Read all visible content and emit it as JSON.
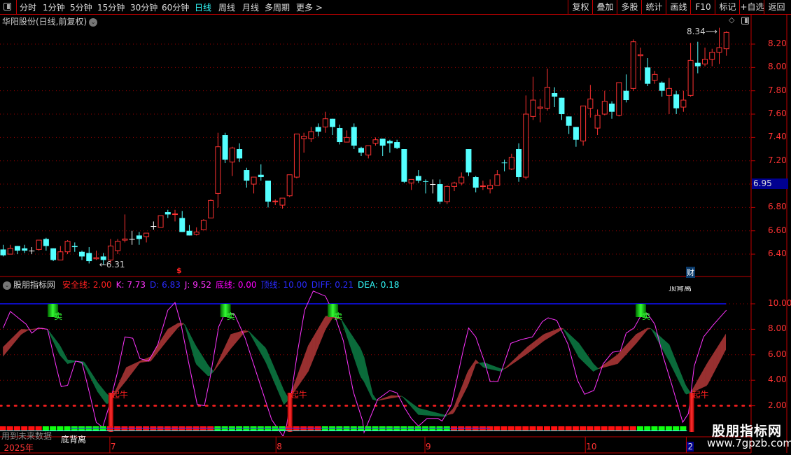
{
  "toolbar": {
    "periods": [
      {
        "label": "分时",
        "active": false
      },
      {
        "label": "1分钟",
        "active": false
      },
      {
        "label": "5分钟",
        "active": false
      },
      {
        "label": "15分钟",
        "active": false
      },
      {
        "label": "30分钟",
        "active": false
      },
      {
        "label": "60分钟",
        "active": false
      },
      {
        "label": "日线",
        "active": true
      },
      {
        "label": "周线",
        "active": false
      },
      {
        "label": "月线",
        "active": false
      },
      {
        "label": "多周期",
        "active": false
      },
      {
        "label": "更多 >",
        "active": false
      }
    ],
    "buttons": [
      "复权",
      "叠加",
      "多股",
      "统计",
      "画线",
      "F10",
      "标记",
      "+自选",
      "返回"
    ]
  },
  "chart_title": "华阳股份(日线,前复权)",
  "price_axis": [
    "8.20",
    "8.00",
    "7.80",
    "7.60",
    "7.40",
    "7.20",
    "6.80",
    "6.60",
    "6.40"
  ],
  "current_price_label": "6.95",
  "annotations": {
    "low_label": "6.31",
    "high_label": "8.34",
    "event_marker": "$",
    "finance_marker": "财"
  },
  "indicator": {
    "name": "股朋指标网",
    "values": [
      {
        "text": "安全线: 2.00",
        "color": "#ff2020"
      },
      {
        "text": "K: 7.73",
        "color": "#ff33ff"
      },
      {
        "text": "D: 6.83",
        "color": "#2a2aff"
      },
      {
        "text": "J: 9.52",
        "color": "#ff33ff"
      },
      {
        "text": "底线: 0.00",
        "color": "#ff00ff"
      },
      {
        "text": "顶线: 10.00",
        "color": "#2a2aff"
      },
      {
        "text": "DIFF: 0.21",
        "color": "#2a2aff"
      },
      {
        "text": "DEA: 0.18",
        "color": "#33ffff"
      }
    ],
    "axis": [
      "10.00",
      "8.00",
      "6.00",
      "4.00",
      "2.00"
    ],
    "sell_label": "卖",
    "buy_label": "起牛",
    "top_divergence": "顶背离",
    "bottom_divergence": "底背离",
    "future_data_note": "用到未来数据"
  },
  "time_axis": [
    {
      "label": "2025年",
      "index": 0
    },
    {
      "label": "7",
      "index": 14.9
    },
    {
      "label": "8",
      "index": 38.1
    },
    {
      "label": "9",
      "index": 58.9
    },
    {
      "label": "10",
      "index": 81.3
    },
    {
      "label": "2",
      "index": 95.4,
      "highlight": true
    }
  ],
  "watermark": {
    "title": "股朋指标网",
    "url": "www.7gpzb.com"
  },
  "colors": {
    "up": "#ff3232",
    "down": "#54ffff",
    "doji": "#ffffff",
    "rise_band": "#983030",
    "fall_band": "#0b6b3b",
    "j_line": "#ff33ff",
    "top_line": "#1010ff",
    "grid": "#a00000"
  },
  "chart_data": {
    "type": "candlestick",
    "ohlc_fields": [
      "open",
      "high",
      "low",
      "close"
    ],
    "ylim": [
      6.3,
      8.4
    ],
    "low_index": 14,
    "high_index": 100,
    "candles": [
      [
        6.44,
        6.48,
        6.38,
        6.39
      ],
      [
        6.4,
        6.48,
        6.4,
        6.45
      ],
      [
        6.47,
        6.47,
        6.4,
        6.43
      ],
      [
        6.45,
        6.48,
        6.41,
        6.43
      ],
      [
        6.43,
        6.46,
        6.4,
        6.43
      ],
      [
        6.44,
        6.52,
        6.43,
        6.52
      ],
      [
        6.53,
        6.54,
        6.43,
        6.47
      ],
      [
        6.45,
        6.45,
        6.34,
        6.35
      ],
      [
        6.35,
        6.47,
        6.35,
        6.42
      ],
      [
        6.42,
        6.52,
        6.4,
        6.51
      ],
      [
        6.47,
        6.5,
        6.42,
        6.46
      ],
      [
        6.42,
        6.43,
        6.35,
        6.38
      ],
      [
        6.41,
        6.46,
        6.32,
        6.34
      ],
      [
        6.36,
        6.43,
        6.35,
        6.37
      ],
      [
        6.38,
        6.41,
        6.31,
        6.35
      ],
      [
        6.35,
        6.53,
        6.32,
        6.47
      ],
      [
        6.43,
        6.53,
        6.4,
        6.51
      ],
      [
        6.52,
        6.74,
        6.5,
        6.53
      ],
      [
        6.53,
        6.6,
        6.48,
        6.53
      ],
      [
        6.56,
        6.59,
        6.48,
        6.53
      ],
      [
        6.55,
        6.58,
        6.5,
        6.58
      ],
      [
        6.64,
        6.68,
        6.61,
        6.64
      ],
      [
        6.63,
        6.73,
        6.63,
        6.73
      ],
      [
        6.76,
        6.78,
        6.71,
        6.74
      ],
      [
        6.74,
        6.78,
        6.68,
        6.745
      ],
      [
        6.71,
        6.77,
        6.59,
        6.59
      ],
      [
        6.6,
        6.65,
        6.56,
        6.56
      ],
      [
        6.57,
        6.63,
        6.56,
        6.59
      ],
      [
        6.61,
        6.7,
        6.61,
        6.69
      ],
      [
        6.71,
        6.87,
        6.71,
        6.86
      ],
      [
        6.92,
        7.44,
        6.8,
        7.32
      ],
      [
        7.42,
        7.44,
        7.18,
        7.21
      ],
      [
        7.19,
        7.32,
        7.07,
        7.31
      ],
      [
        7.3,
        7.35,
        7.19,
        7.22
      ],
      [
        7.12,
        7.14,
        6.97,
        7.03
      ],
      [
        7.0,
        7.06,
        6.92,
        7.06
      ],
      [
        7.08,
        7.17,
        7.03,
        7.06
      ],
      [
        7.03,
        7.03,
        6.8,
        6.85
      ],
      [
        6.85,
        6.87,
        6.82,
        6.855
      ],
      [
        6.82,
        6.88,
        6.79,
        6.88
      ],
      [
        6.9,
        7.08,
        6.89,
        7.08
      ],
      [
        7.06,
        7.43,
        7.05,
        7.43
      ],
      [
        7.39,
        7.44,
        7.27,
        7.41
      ],
      [
        7.39,
        7.49,
        7.36,
        7.45
      ],
      [
        7.49,
        7.52,
        7.41,
        7.45
      ],
      [
        7.49,
        7.62,
        7.44,
        7.56
      ],
      [
        7.56,
        7.56,
        7.42,
        7.49
      ],
      [
        7.48,
        7.51,
        7.34,
        7.36
      ],
      [
        7.36,
        7.46,
        7.36,
        7.4
      ],
      [
        7.49,
        7.52,
        7.3,
        7.33
      ],
      [
        7.31,
        7.32,
        7.24,
        7.27
      ],
      [
        7.25,
        7.33,
        7.22,
        7.33
      ],
      [
        7.35,
        7.4,
        7.33,
        7.38
      ],
      [
        7.39,
        7.39,
        7.24,
        7.33
      ],
      [
        7.37,
        7.38,
        7.27,
        7.35
      ],
      [
        7.36,
        7.38,
        7.3,
        7.31
      ],
      [
        7.3,
        7.3,
        7.01,
        7.02
      ],
      [
        7.01,
        7.04,
        6.95,
        7.04
      ],
      [
        7.07,
        7.12,
        7.01,
        7.03
      ],
      [
        7.025,
        7.04,
        6.92,
        7.02
      ],
      [
        7.0,
        7.04,
        6.92,
        7.0
      ],
      [
        7.0,
        7.04,
        6.83,
        6.85
      ],
      [
        6.85,
        6.99,
        6.83,
        6.98
      ],
      [
        6.98,
        7.02,
        6.94,
        7.01
      ],
      [
        7.01,
        7.1,
        6.99,
        7.06
      ],
      [
        7.3,
        7.3,
        7.07,
        7.1
      ],
      [
        7.06,
        7.07,
        6.93,
        6.97
      ],
      [
        6.98,
        7.03,
        6.95,
        6.985
      ],
      [
        6.96,
        7.04,
        6.92,
        6.99
      ],
      [
        6.99,
        7.12,
        6.99,
        7.08
      ],
      [
        7.185,
        7.21,
        7.11,
        7.18
      ],
      [
        7.13,
        7.26,
        7.12,
        7.23
      ],
      [
        7.3,
        7.35,
        7.02,
        7.06
      ],
      [
        7.06,
        7.76,
        7.04,
        7.6
      ],
      [
        7.58,
        7.92,
        7.55,
        7.72
      ],
      [
        7.65,
        7.73,
        7.53,
        7.66
      ],
      [
        7.65,
        7.99,
        7.63,
        7.83
      ],
      [
        7.78,
        7.83,
        7.66,
        7.75
      ],
      [
        7.74,
        7.74,
        7.55,
        7.6
      ],
      [
        7.58,
        7.58,
        7.43,
        7.5
      ],
      [
        7.49,
        7.49,
        7.32,
        7.38
      ],
      [
        7.37,
        7.67,
        7.33,
        7.67
      ],
      [
        7.65,
        7.85,
        7.57,
        7.73
      ],
      [
        7.48,
        7.64,
        7.42,
        7.59
      ],
      [
        7.6,
        7.8,
        7.59,
        7.71
      ],
      [
        7.69,
        7.71,
        7.56,
        7.62
      ],
      [
        7.59,
        7.87,
        7.58,
        7.87
      ],
      [
        7.8,
        7.94,
        7.7,
        7.72
      ],
      [
        7.82,
        8.24,
        7.8,
        8.22
      ],
      [
        8.1,
        8.17,
        7.89,
        8.11
      ],
      [
        8.0,
        8.08,
        7.84,
        7.86
      ],
      [
        7.89,
        7.97,
        7.86,
        7.94
      ],
      [
        7.87,
        7.88,
        7.75,
        7.8
      ],
      [
        7.76,
        7.91,
        7.6,
        7.82
      ],
      [
        7.77,
        7.8,
        7.6,
        7.65
      ],
      [
        7.66,
        7.8,
        7.62,
        7.72
      ],
      [
        7.76,
        8.21,
        7.75,
        8.06
      ],
      [
        8.04,
        8.22,
        7.95,
        8.01
      ],
      [
        8.03,
        8.17,
        8.01,
        8.07
      ],
      [
        8.07,
        8.16,
        8.01,
        8.13
      ],
      [
        8.13,
        8.34,
        8.03,
        8.17
      ],
      [
        8.16,
        8.31,
        8.1,
        8.3
      ]
    ],
    "indicator": {
      "ylim": [
        0,
        10
      ],
      "top_line": 10,
      "safety_line": 2,
      "kd_keyframes_index_k_d": [
        [
          0,
          6.6,
          5.9
        ],
        [
          2.5,
          8.0,
          7.6
        ],
        [
          3.5,
          7.97,
          7.95
        ],
        [
          5.4,
          8.1,
          8.05
        ],
        [
          6.2,
          8.0,
          8.0
        ],
        [
          7.9,
          6.0,
          6.75
        ],
        [
          9.0,
          5.3,
          5.6
        ],
        [
          10.3,
          5.5,
          5.5
        ],
        [
          11.3,
          5.2,
          5.45
        ],
        [
          13.2,
          3.1,
          3.8
        ],
        [
          14.5,
          2.1,
          2.9
        ],
        [
          15.2,
          2.6,
          2.6
        ],
        [
          17.2,
          5.0,
          4.0
        ],
        [
          19.1,
          5.5,
          5.4
        ],
        [
          20.6,
          5.85,
          5.5
        ],
        [
          23.0,
          8.0,
          7.2
        ],
        [
          24.5,
          8.5,
          8.2
        ],
        [
          25.3,
          8.45,
          8.45
        ],
        [
          26.9,
          5.3,
          6.7
        ],
        [
          28.7,
          4.3,
          5.1
        ],
        [
          29.4,
          4.7,
          4.7
        ],
        [
          31.8,
          7.6,
          6.5
        ],
        [
          33.6,
          7.9,
          7.7
        ],
        [
          34.3,
          7.85,
          7.85
        ],
        [
          36.7,
          5.4,
          6.5
        ],
        [
          39.2,
          2.1,
          3.2
        ],
        [
          39.9,
          2.5,
          2.5
        ],
        [
          42.6,
          6.7,
          4.7
        ],
        [
          45.0,
          9.0,
          8.0
        ],
        [
          46.0,
          9.15,
          8.9
        ],
        [
          47.2,
          8.8,
          8.8
        ],
        [
          49.9,
          4.3,
          6.5
        ],
        [
          50.4,
          3.9,
          5.8
        ],
        [
          51.6,
          2.5,
          2.9
        ],
        [
          52.2,
          2.4,
          2.4
        ],
        [
          54.2,
          2.8,
          2.6
        ],
        [
          55.7,
          2.75,
          2.75
        ],
        [
          58.0,
          1.3,
          1.8
        ],
        [
          61.8,
          1.15,
          1.25
        ],
        [
          62.9,
          1.8,
          1.4
        ],
        [
          64.9,
          4.7,
          3.6
        ],
        [
          66.0,
          5.6,
          5.3
        ],
        [
          67.1,
          5.0,
          5.4
        ],
        [
          69.5,
          4.7,
          4.9
        ],
        [
          70.1,
          4.95,
          4.9
        ],
        [
          73.2,
          6.6,
          6.1
        ],
        [
          75.5,
          7.6,
          7.1
        ],
        [
          77.8,
          8.1,
          7.9
        ],
        [
          78.2,
          8.05,
          8.05
        ],
        [
          80.4,
          5.8,
          6.9
        ],
        [
          82.4,
          4.7,
          5.3
        ],
        [
          83.1,
          4.9,
          4.9
        ],
        [
          85.8,
          6.0,
          5.3
        ],
        [
          88.4,
          7.6,
          6.9
        ],
        [
          90.0,
          8.1,
          8.0
        ],
        [
          90.5,
          8.05,
          8.05
        ],
        [
          93.0,
          5.5,
          6.8
        ],
        [
          95.3,
          2.9,
          3.6
        ],
        [
          96.0,
          3.0,
          3.0
        ],
        [
          98.3,
          5.3,
          3.6
        ],
        [
          100.9,
          7.6,
          6.4
        ]
      ],
      "j_keyframes_index_value": [
        [
          0,
          8.1
        ],
        [
          1.0,
          9.4
        ],
        [
          3.2,
          8.4
        ],
        [
          4.0,
          7.7
        ],
        [
          4.9,
          8.1
        ],
        [
          6.2,
          8.0
        ],
        [
          7.4,
          5.1
        ],
        [
          8.1,
          3.5
        ],
        [
          9.0,
          3.6
        ],
        [
          10.1,
          5.5
        ],
        [
          11.0,
          5.4
        ],
        [
          12.1,
          2.9
        ],
        [
          13.0,
          0.7
        ],
        [
          13.9,
          0.3
        ],
        [
          14.7,
          1.8
        ],
        [
          16.0,
          4.7
        ],
        [
          17.0,
          7.4
        ],
        [
          18.1,
          7.3
        ],
        [
          19.1,
          5.7
        ],
        [
          20.3,
          5.5
        ],
        [
          21.6,
          6.8
        ],
        [
          23.0,
          9.5
        ],
        [
          24.0,
          10.1
        ],
        [
          24.8,
          8.5
        ],
        [
          25.9,
          5.4
        ],
        [
          27.1,
          2.1
        ],
        [
          28.1,
          2.0
        ],
        [
          28.9,
          4.2
        ],
        [
          30.1,
          8.2
        ],
        [
          31.0,
          9.3
        ],
        [
          32.3,
          9.2
        ],
        [
          33.8,
          7.3
        ],
        [
          35.7,
          4.0
        ],
        [
          37.5,
          0.9
        ],
        [
          39.1,
          -0.4
        ],
        [
          39.6,
          0.5
        ],
        [
          41.1,
          6.2
        ],
        [
          42.1,
          9.5
        ],
        [
          43.3,
          11.0
        ],
        [
          45.0,
          10.6
        ],
        [
          46.3,
          9.1
        ],
        [
          47.5,
          7.1
        ],
        [
          48.9,
          3.1
        ],
        [
          50.2,
          0.8
        ],
        [
          50.4,
          -0.1
        ],
        [
          52.3,
          2.5
        ],
        [
          54.0,
          3.2
        ],
        [
          55.0,
          3.0
        ],
        [
          56.1,
          1.8
        ],
        [
          57.0,
          1.0
        ],
        [
          58.0,
          0.4
        ],
        [
          59.2,
          1.0
        ],
        [
          60.7,
          1.0
        ],
        [
          61.3,
          0.8
        ],
        [
          62.6,
          2.1
        ],
        [
          64.3,
          6.5
        ],
        [
          65.0,
          8.1
        ],
        [
          66.0,
          7.4
        ],
        [
          67.3,
          5.3
        ],
        [
          68.0,
          3.9
        ],
        [
          69.1,
          3.9
        ],
        [
          70.9,
          6.9
        ],
        [
          72.4,
          7.2
        ],
        [
          73.9,
          7.4
        ],
        [
          75.3,
          8.6
        ],
        [
          76.1,
          8.9
        ],
        [
          77.3,
          8.7
        ],
        [
          78.9,
          6.8
        ],
        [
          80.2,
          4.0
        ],
        [
          81.2,
          2.9
        ],
        [
          82.5,
          3.2
        ],
        [
          83.8,
          5.3
        ],
        [
          85.1,
          6.2
        ],
        [
          86.2,
          6.3
        ],
        [
          87.0,
          7.7
        ],
        [
          88.1,
          8.1
        ],
        [
          89.2,
          9.2
        ],
        [
          90.0,
          9.2
        ],
        [
          91.0,
          8.4
        ],
        [
          92.2,
          5.8
        ],
        [
          93.4,
          3.6
        ],
        [
          94.9,
          0.7
        ],
        [
          95.7,
          1.4
        ],
        [
          96.5,
          5.1
        ],
        [
          97.8,
          7.4
        ],
        [
          99.1,
          8.3
        ],
        [
          101,
          9.5
        ]
      ],
      "sell_signals_index": [
        6.9,
        31.0,
        46.0,
        89.0
      ],
      "buy_signals_index": [
        15.0,
        40.0,
        96.1
      ],
      "strip_segments": [
        {
          "from": 0,
          "to": 5,
          "color": "red"
        },
        {
          "from": 6,
          "to": 14,
          "color": "green"
        },
        {
          "from": 15,
          "to": 29,
          "color": "red"
        },
        {
          "from": 30,
          "to": 39,
          "color": "green"
        },
        {
          "from": 40,
          "to": 44,
          "color": "red"
        },
        {
          "from": 45,
          "to": 62,
          "color": "green"
        },
        {
          "from": 63,
          "to": 88,
          "color": "red"
        },
        {
          "from": 89,
          "to": 95,
          "color": "green"
        }
      ]
    }
  }
}
